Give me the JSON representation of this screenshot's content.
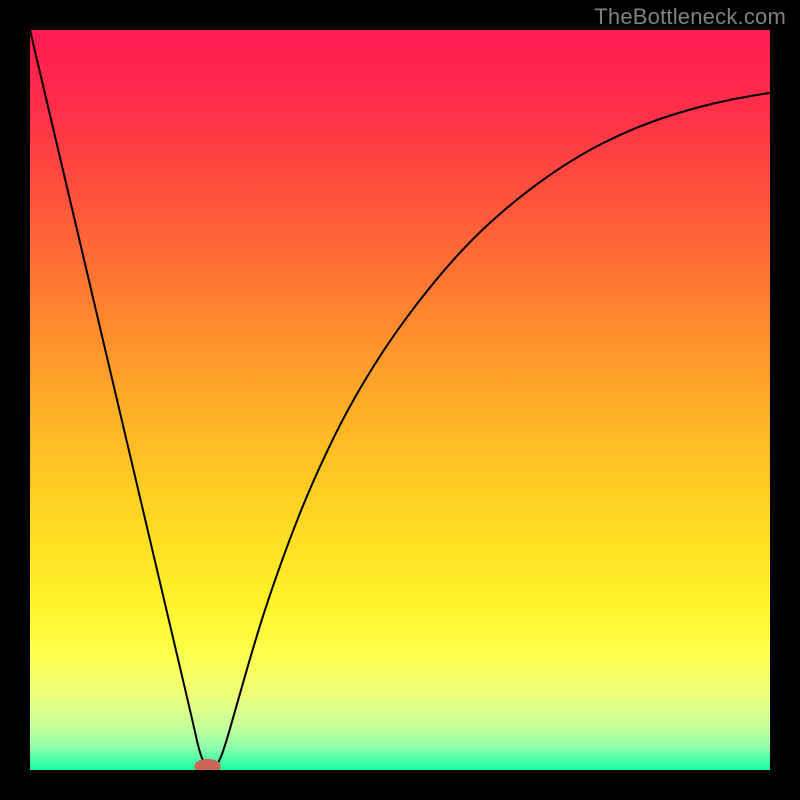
{
  "watermark": "TheBottleneck.com",
  "chart_data": {
    "type": "line",
    "title": "",
    "xlabel": "",
    "ylabel": "",
    "xlim": [
      0,
      100
    ],
    "ylim": [
      0,
      100
    ],
    "background_gradient": {
      "orientation": "vertical",
      "stops": [
        {
          "offset": 0.0,
          "color": "#ff1b52"
        },
        {
          "offset": 0.1,
          "color": "#ff2d49"
        },
        {
          "offset": 0.2,
          "color": "#ff4a3e"
        },
        {
          "offset": 0.3,
          "color": "#ff6a35"
        },
        {
          "offset": 0.4,
          "color": "#ff8b2d"
        },
        {
          "offset": 0.5,
          "color": "#ffab27"
        },
        {
          "offset": 0.6,
          "color": "#ffc823"
        },
        {
          "offset": 0.7,
          "color": "#ffe223"
        },
        {
          "offset": 0.78,
          "color": "#fff42c"
        },
        {
          "offset": 0.84,
          "color": "#fdff4a"
        },
        {
          "offset": 0.9,
          "color": "#ecff7a"
        },
        {
          "offset": 0.94,
          "color": "#c8ff99"
        },
        {
          "offset": 0.97,
          "color": "#8dffaa"
        },
        {
          "offset": 1.0,
          "color": "#15ffa5"
        }
      ]
    },
    "series": [
      {
        "name": "bottleneck-curve",
        "color": "#000000",
        "stroke_width": 2,
        "x": [
          0,
          2,
          4,
          6,
          8,
          10,
          12,
          14,
          16,
          18,
          20,
          22,
          23,
          24,
          25,
          26,
          28,
          30,
          32,
          35,
          38,
          42,
          46,
          50,
          55,
          60,
          65,
          70,
          75,
          80,
          85,
          90,
          95,
          100
        ],
        "y": [
          100,
          91.5,
          83.0,
          74.5,
          66.0,
          57.5,
          49.0,
          40.5,
          32.0,
          23.5,
          15.0,
          6.5,
          2.0,
          0.0,
          0.3,
          2.0,
          9.0,
          16.0,
          22.5,
          31.0,
          38.5,
          47.0,
          54.0,
          60.0,
          66.5,
          72.0,
          76.5,
          80.3,
          83.5,
          86.0,
          88.0,
          89.5,
          90.7,
          91.5
        ]
      }
    ],
    "marker": {
      "name": "optimal-point",
      "x": 24,
      "y": 0.5,
      "rx": 1.8,
      "ry": 1.0,
      "color": "#cc6655"
    }
  }
}
